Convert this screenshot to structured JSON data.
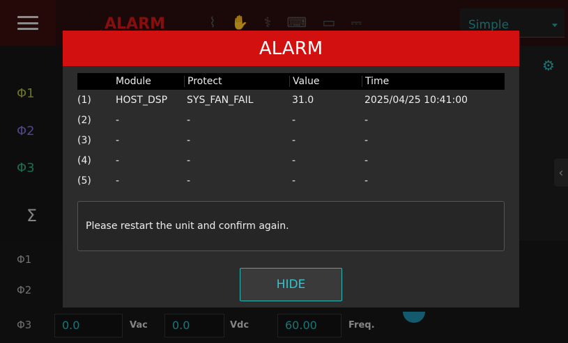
{
  "topbar": {
    "menu_icon": "hamburger-menu-icon",
    "alarm_label": "ALARM",
    "mode_value": "Simple",
    "icons": [
      "waveform-icon",
      "hand-icon",
      "network-icon",
      "keyboard-icon",
      "monitor-icon",
      "usb-icon"
    ]
  },
  "left": {
    "phase1": "Φ1",
    "phase2": "Φ2",
    "phase3": "Φ3",
    "sum": "Σ"
  },
  "bottom": {
    "phase1": "Φ1",
    "phase2": "Φ2",
    "phase3": "Φ3",
    "vac_value": "0.0",
    "vac_unit": "Vac",
    "vdc_value": "0.0",
    "vdc_unit": "Vdc",
    "freq_value": "60.00",
    "freq_unit": "Freq."
  },
  "dialog": {
    "title": "ALARM",
    "columns": [
      "",
      "Module",
      "Protect",
      "Value",
      "Time"
    ],
    "rows": [
      [
        "(1)",
        "HOST_DSP",
        "SYS_FAN_FAIL",
        "31.0",
        "2025/04/25 10:41:00"
      ],
      [
        "(2)",
        "-",
        "-",
        "-",
        "-"
      ],
      [
        "(3)",
        "-",
        "-",
        "-",
        "-"
      ],
      [
        "(4)",
        "-",
        "-",
        "-",
        "-"
      ],
      [
        "(5)",
        "-",
        "-",
        "-",
        "-"
      ]
    ],
    "message": "Please restart the unit and confirm again.",
    "hide_label": "HIDE"
  },
  "colors": {
    "alarm_red": "#d21010",
    "accent_teal": "#2ab4b4",
    "phase1": "#a8b22a",
    "phase2": "#7a6ad0",
    "phase3": "#2aa87a"
  }
}
